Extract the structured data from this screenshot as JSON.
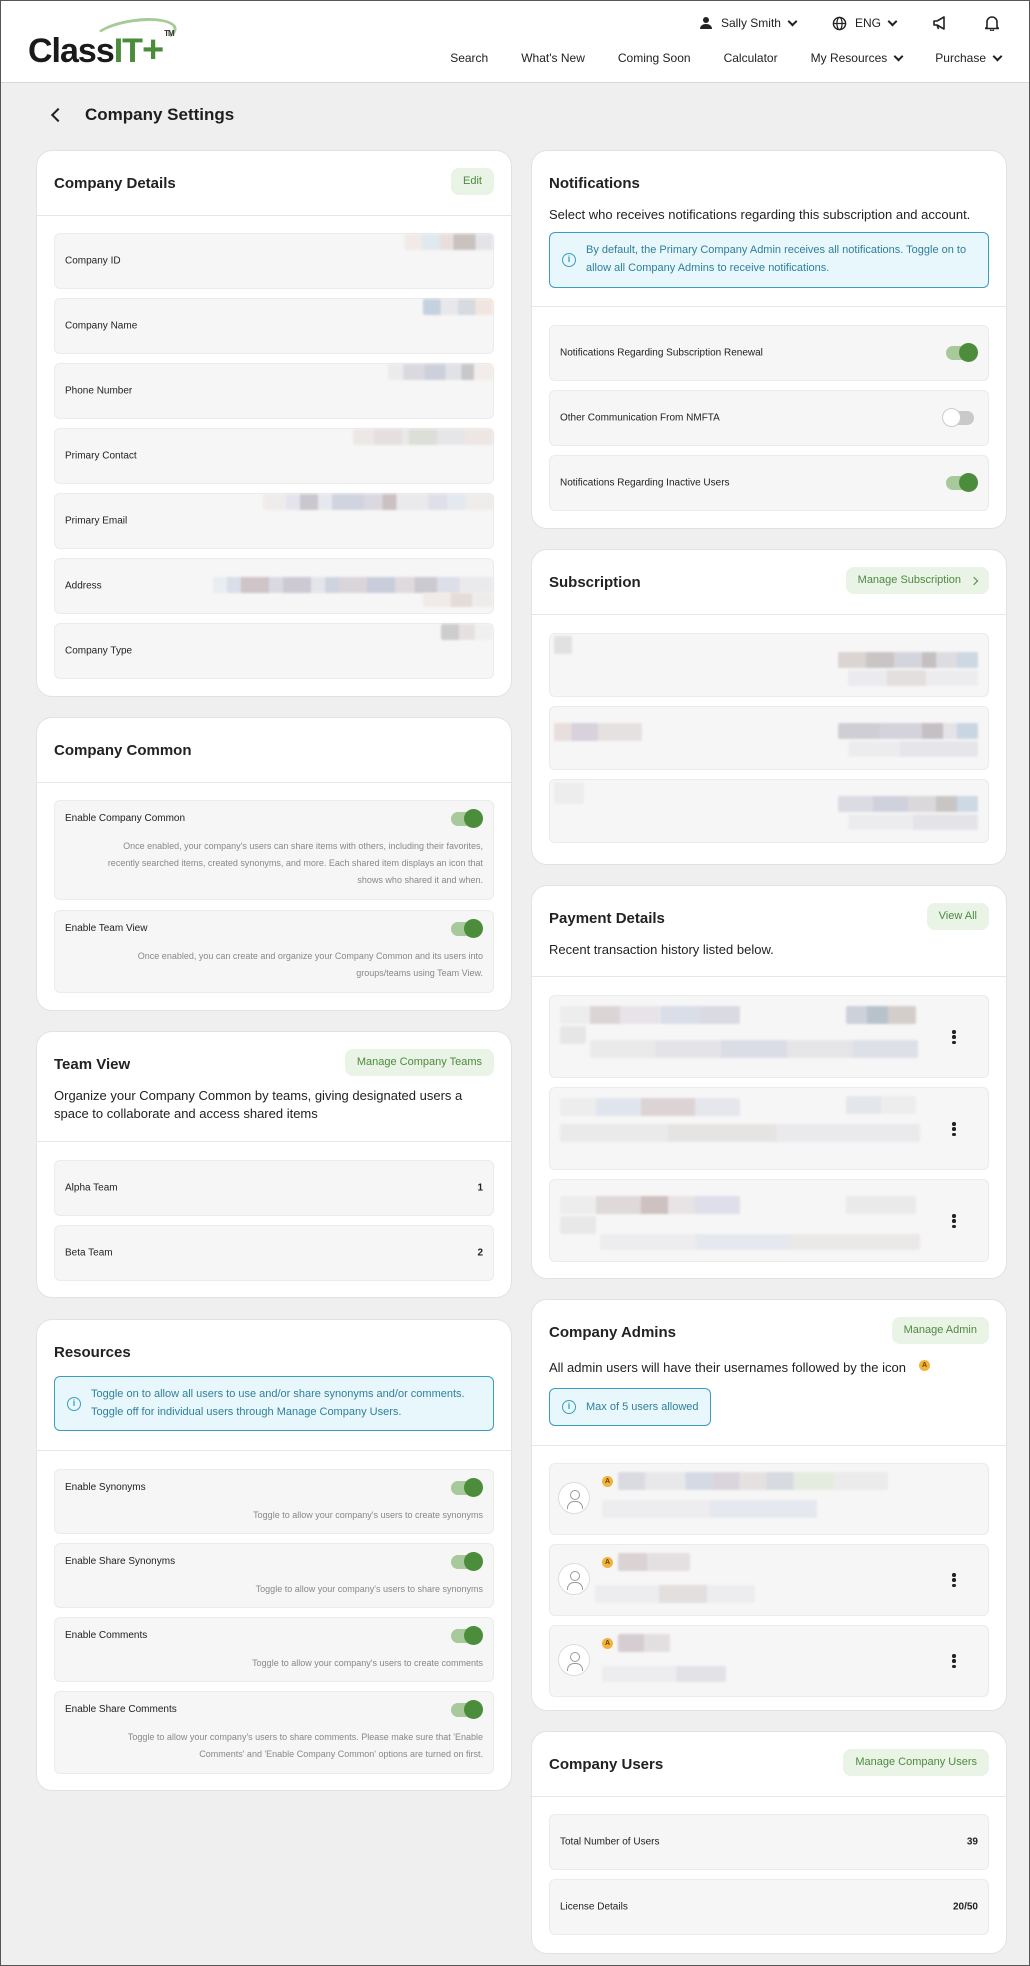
{
  "header": {
    "logo": {
      "class": "Class",
      "it": "IT",
      "plus": "+",
      "tm": "TM"
    },
    "user_name": "Sally Smith",
    "language": "ENG",
    "nav": [
      "Search",
      "What's New",
      "Coming Soon",
      "Calculator",
      "My Resources",
      "Purchase"
    ]
  },
  "page": {
    "title": "Company Settings"
  },
  "company_details": {
    "title": "Company Details",
    "edit_label": "Edit",
    "fields": [
      "Company ID",
      "Company Name",
      "Phone Number",
      "Primary Contact",
      "Primary Email",
      "Address",
      "Company Type"
    ]
  },
  "company_common": {
    "title": "Company Common",
    "items": [
      {
        "label": "Enable Company Common",
        "enabled": true,
        "desc1": "Once enabled, your company's users can share items with others, including their favorites,",
        "desc2": "recently searched items, created synonyms, and more. Each shared item displays an icon that",
        "desc3": "shows who shared it and when."
      },
      {
        "label": "Enable Team View",
        "enabled": true,
        "desc1": "Once enabled, you can create and organize your Company Common and its users into",
        "desc2": "groups/teams using Team View."
      }
    ]
  },
  "team_view": {
    "title": "Team View",
    "button": "Manage Company Teams",
    "subtitle1": "Organize your Company Common by teams, giving designated users a",
    "subtitle2": "space to collaborate and access shared items",
    "teams": [
      {
        "name": "Alpha Team",
        "count": "1"
      },
      {
        "name": "Beta Team",
        "count": "2"
      }
    ]
  },
  "resources": {
    "title": "Resources",
    "info1": "Toggle on to allow all users to use and/or share synonyms and/or comments.",
    "info2": "Toggle off for individual users through Manage Company Users.",
    "items": [
      {
        "label": "Enable Synonyms",
        "enabled": true,
        "desc": "Toggle to allow your company's users to create synonyms"
      },
      {
        "label": "Enable Share Synonyms",
        "enabled": true,
        "desc": "Toggle to allow your company's users to share synonyms"
      },
      {
        "label": "Enable Comments",
        "enabled": true,
        "desc": "Toggle to allow your company's users to create comments"
      },
      {
        "label": "Enable Share Comments",
        "enabled": true,
        "desc1": "Toggle to allow your company's users to share comments. Please make sure that 'Enable",
        "desc2": "Comments' and 'Enable Company Common' options are turned on first."
      }
    ]
  },
  "notifications": {
    "title": "Notifications",
    "subtitle": "Select who receives notifications regarding this subscription and account.",
    "info1": "By default, the Primary Company Admin receives all notifications. Toggle on to",
    "info2": "allow all Company Admins to receive notifications.",
    "items": [
      {
        "label": "Notifications Regarding Subscription Renewal",
        "enabled": true
      },
      {
        "label": "Other Communication From NMFTA",
        "enabled": false
      },
      {
        "label": "Notifications Regarding Inactive Users",
        "enabled": true
      }
    ]
  },
  "subscription": {
    "title": "Subscription",
    "button": "Manage Subscription"
  },
  "payment": {
    "title": "Payment Details",
    "button": "View All",
    "subtitle": "Recent transaction history listed below."
  },
  "admins": {
    "title": "Company Admins",
    "button": "Manage Admin",
    "subtitle": "All admin users will have their usernames followed by the icon",
    "badge_letter": "A",
    "max_note": "Max of 5 users allowed"
  },
  "company_users": {
    "title": "Company Users",
    "button": "Manage Company Users",
    "rows": [
      {
        "label": "Total Number of Users",
        "value": "39"
      },
      {
        "label": "License Details",
        "value": "20/50"
      }
    ]
  },
  "colors": {
    "accent": "#4b8d3b",
    "accent_light": "#e9f3e6",
    "info": "#3b9dbd",
    "badge": "#f2b33d"
  }
}
